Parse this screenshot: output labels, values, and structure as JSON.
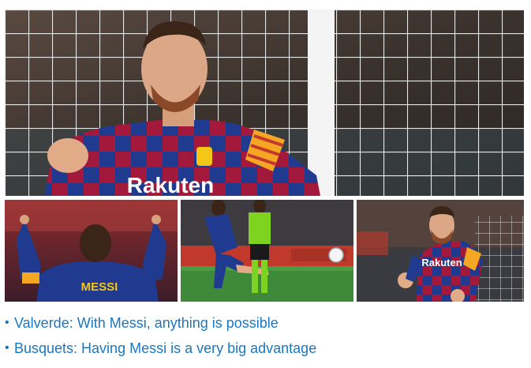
{
  "images": {
    "main": {
      "subject": "messi-celebrating-net-background",
      "shirt_text": "Rakuten"
    },
    "thumbnails": [
      {
        "subject": "messi-pointing-skyward-back-view",
        "shirt_name": "MESSI"
      },
      {
        "subject": "messi-taking-penalty-kick"
      },
      {
        "subject": "messi-celebrating-fists",
        "shirt_text": "Rakuten"
      }
    ]
  },
  "related_links": [
    {
      "text": "Valverde: With Messi, anything is possible"
    },
    {
      "text": "Busquets: Having Messi is a very big advantage"
    }
  ],
  "colors": {
    "link": "#1a78c2",
    "barca_blue": "#1f3a8f",
    "barca_red": "#a3193b",
    "pitch_green": "#3f8a3a"
  }
}
